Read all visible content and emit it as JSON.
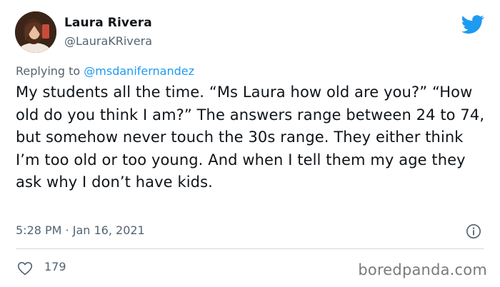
{
  "user": {
    "display_name": "Laura Rivera",
    "handle": "@LauraKRivera"
  },
  "reply": {
    "prefix": "Replying to ",
    "mention": "@msdanifernandez"
  },
  "tweet": {
    "text": "My students all the time. “Ms Laura how old are you?” “How old do you think I am?” The answers range between 24 to 74, but somehow never touch the 30s range. They either think I’m too old or too young. And when I tell them my age they ask why I don’t have kids.",
    "timestamp": "5:28 PM · Jan 16, 2021"
  },
  "stats": {
    "likes": "179"
  },
  "watermark": "boredpanda.com",
  "colors": {
    "twitter_blue": "#1d9bf0",
    "secondary_text": "#536471",
    "divider": "#cfd9de"
  },
  "icons": {
    "brand": "twitter-bird-icon",
    "info": "info-icon",
    "like": "heart-icon"
  }
}
